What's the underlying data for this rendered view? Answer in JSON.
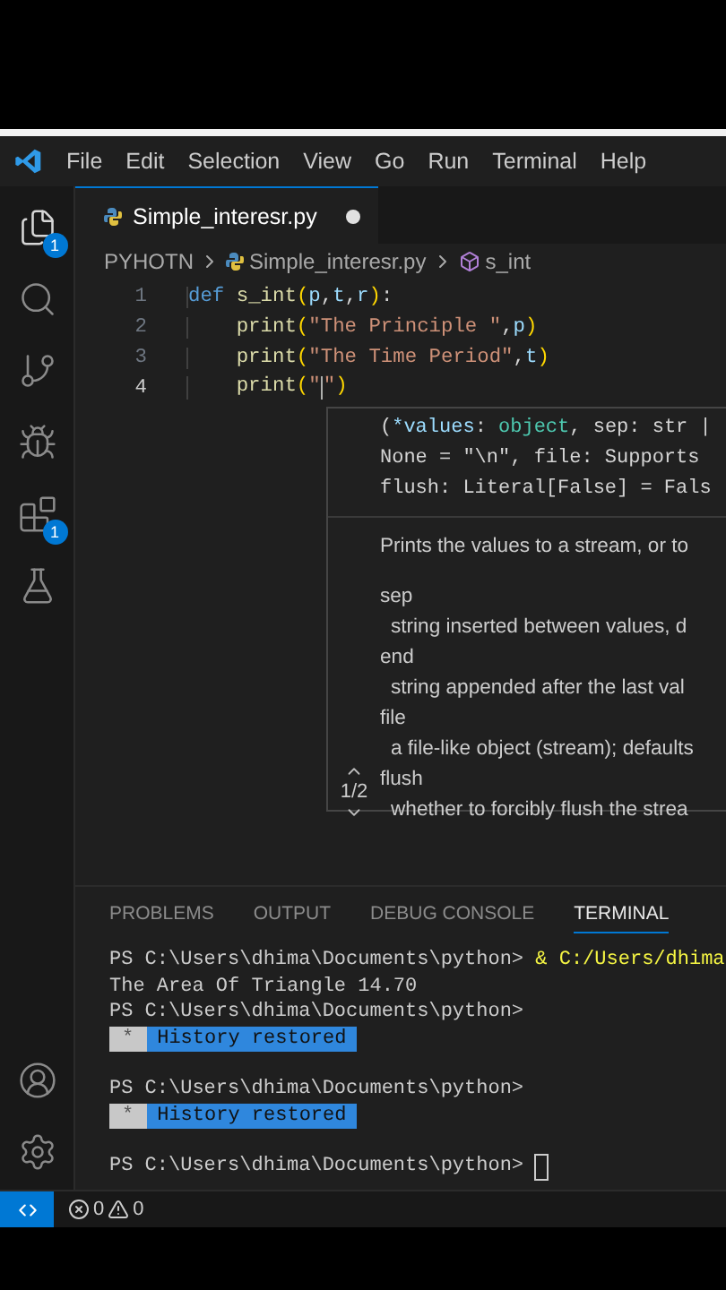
{
  "menu_bar": {
    "items": [
      "File",
      "Edit",
      "Selection",
      "View",
      "Go",
      "Run",
      "Terminal",
      "Help"
    ]
  },
  "activity_bar": {
    "top": [
      {
        "kind": "files",
        "badge": "1",
        "selected": true
      },
      {
        "kind": "search",
        "selected": false
      },
      {
        "kind": "source-control",
        "selected": false
      },
      {
        "kind": "run-debug",
        "selected": false
      },
      {
        "kind": "extensions",
        "badge": "1",
        "selected": false
      },
      {
        "kind": "testing",
        "selected": false
      }
    ],
    "bottom": [
      {
        "kind": "account"
      },
      {
        "kind": "settings"
      }
    ]
  },
  "tabs": [
    {
      "label": "Simple_interesr.py",
      "modified": true,
      "selected": true
    }
  ],
  "breadcrumb": [
    {
      "label": "PYHOTN",
      "kind": "folder"
    },
    {
      "label": "Simple_interesr.py",
      "kind": "file"
    },
    {
      "label": "s_int",
      "kind": "symbol"
    }
  ],
  "code": [
    {
      "number": "1",
      "current": false,
      "tokens": [
        {
          "text": "def ",
          "kind": "keyword"
        },
        {
          "text": "s_int",
          "kind": "function"
        },
        {
          "text": "(",
          "kind": "bracket"
        },
        {
          "text": "p",
          "kind": "param"
        },
        {
          "text": ",",
          "kind": "plain"
        },
        {
          "text": "t",
          "kind": "param"
        },
        {
          "text": ",",
          "kind": "plain"
        },
        {
          "text": "r",
          "kind": "param"
        },
        {
          "text": ")",
          "kind": "bracket"
        },
        {
          "text": ":",
          "kind": "plain"
        }
      ]
    },
    {
      "number": "2",
      "current": false,
      "tokens": [
        {
          "kind": "indent"
        },
        {
          "text": "print",
          "kind": "function"
        },
        {
          "text": "(",
          "kind": "bracket2"
        },
        {
          "text": "\"The Principle \"",
          "kind": "string"
        },
        {
          "text": ",",
          "kind": "plain"
        },
        {
          "text": "p",
          "kind": "param"
        },
        {
          "text": ")",
          "kind": "bracket2"
        }
      ]
    },
    {
      "number": "3",
      "current": false,
      "tokens": [
        {
          "kind": "indent"
        },
        {
          "text": "print",
          "kind": "function"
        },
        {
          "text": "(",
          "kind": "bracket2"
        },
        {
          "text": "\"The Time Period\"",
          "kind": "string"
        },
        {
          "text": ",",
          "kind": "plain"
        },
        {
          "text": "t",
          "kind": "param"
        },
        {
          "text": ")",
          "kind": "bracket2"
        }
      ]
    },
    {
      "number": "4",
      "current": true,
      "tokens": [
        {
          "kind": "indent"
        },
        {
          "text": "print",
          "kind": "function"
        },
        {
          "text": "(",
          "kind": "bracket2"
        },
        {
          "text": "\"",
          "kind": "string"
        },
        {
          "kind": "caret"
        },
        {
          "text": "\"",
          "kind": "string"
        },
        {
          "text": ")",
          "kind": "bracket2"
        }
      ]
    }
  ],
  "hover": {
    "signature": [
      [
        {
          "text": "(",
          "kind": "plain"
        },
        {
          "text": "*values",
          "kind": "param"
        },
        {
          "text": ": ",
          "kind": "plain"
        },
        {
          "text": "object",
          "kind": "type"
        },
        {
          "text": ", sep: str |",
          "kind": "plain"
        }
      ],
      [
        {
          "text": "None = \"\\n\", file: Supports",
          "kind": "plain"
        }
      ],
      [
        {
          "text": "flush: Literal[False] = Fals",
          "kind": "plain"
        }
      ]
    ],
    "summary": "Prints the values to a stream, or to",
    "params": [
      {
        "name": "sep",
        "description": "string inserted between values, d"
      },
      {
        "name": "end",
        "description": "string appended after the last val"
      },
      {
        "name": "file",
        "description": "a file-like object (stream); defaults"
      },
      {
        "name": "flush",
        "description": "whether to forcibly flush the strea"
      }
    ],
    "counter": "1/2"
  },
  "panel": {
    "tabs": [
      {
        "label": "PROBLEMS",
        "selected": false
      },
      {
        "label": "OUTPUT",
        "selected": false
      },
      {
        "label": "DEBUG CONSOLE",
        "selected": false
      },
      {
        "label": "TERMINAL",
        "selected": true
      }
    ],
    "terminal": [
      {
        "kind": "prompt",
        "prompt": "PS C:\\Users\\dhima\\Documents\\python>",
        "command": "& C:/Users/dhima"
      },
      {
        "kind": "output",
        "text": "The Area Of Triangle 14.70"
      },
      {
        "kind": "prompt",
        "prompt": "PS C:\\Users\\dhima\\Documents\\python>"
      },
      {
        "kind": "history",
        "mark": "*",
        "text": "History restored"
      },
      {
        "kind": "prompt",
        "prompt": "PS C:\\Users\\dhima\\Documents\\python>"
      },
      {
        "kind": "history",
        "mark": "*",
        "text": "History restored"
      },
      {
        "kind": "prompt",
        "prompt": "PS C:\\Users\\dhima\\Documents\\python>",
        "cursor": true
      }
    ]
  },
  "status_bar": {
    "errors": "0",
    "warnings": "0"
  }
}
